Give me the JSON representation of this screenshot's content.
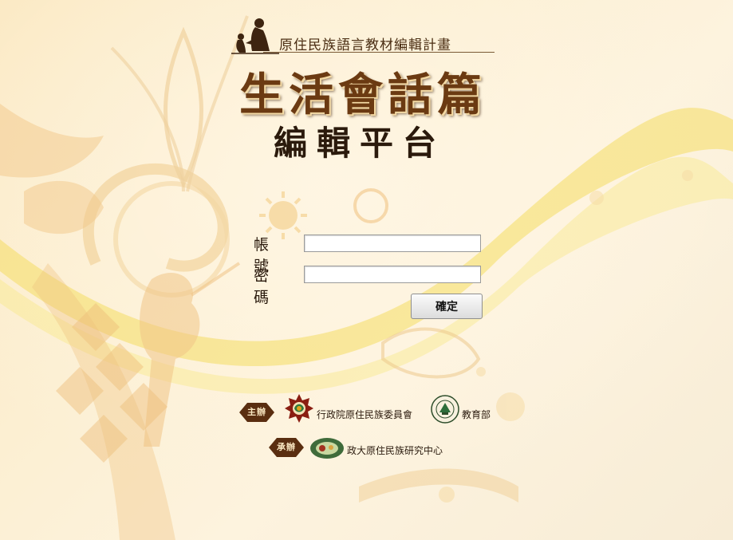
{
  "header": {
    "project_title": "原住民族語言教材編輯計畫",
    "main_title": "生活會話篇",
    "sub_title": "編輯平台"
  },
  "login": {
    "account_label": "帳號",
    "account_value": "",
    "password_label": "密碼",
    "password_value": "",
    "submit_label": "確定"
  },
  "sponsors": {
    "organizer_tag": "主辦",
    "organizers": [
      {
        "name": "行政院原住民族委員會",
        "icon": "council-logo-icon"
      },
      {
        "name": "教育部",
        "icon": "ministry-of-education-seal-icon"
      }
    ],
    "executor_tag": "承辦",
    "executors": [
      {
        "name": "政大原住民族研究中心",
        "icon": "research-center-logo-icon"
      }
    ]
  },
  "colors": {
    "background": "#fbe9c3",
    "title_brown": "#6b3a12",
    "tag_brown": "#5a2e10",
    "ribbon_yellow": "#f2d64a"
  }
}
